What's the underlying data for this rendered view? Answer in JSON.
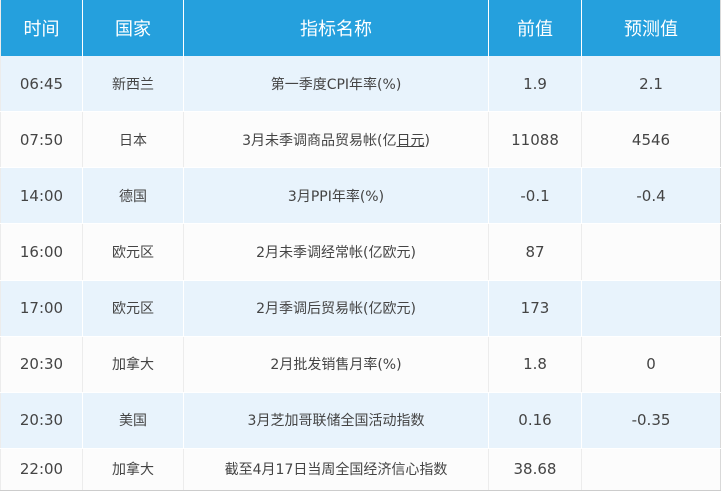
{
  "headers": {
    "time": "时间",
    "country": "国家",
    "indicator": "指标名称",
    "previous": "前值",
    "forecast": "预测值"
  },
  "rows": [
    {
      "time": "06:45",
      "country": "新西兰",
      "indicator": "第一季度CPI年率(%)",
      "previous": "1.9",
      "forecast": "2.1"
    },
    {
      "time": "07:50",
      "country": "日本",
      "indicator_prefix": "3月未季调商品贸易帐(亿",
      "indicator_link": "日元",
      "indicator_suffix": ")",
      "previous": "11088",
      "forecast": "4546"
    },
    {
      "time": "14:00",
      "country": "德国",
      "indicator": "3月PPI年率(%)",
      "previous": "-0.1",
      "forecast": "-0.4"
    },
    {
      "time": "16:00",
      "country": "欧元区",
      "indicator": "2月未季调经常帐(亿欧元)",
      "previous": "87",
      "forecast": ""
    },
    {
      "time": "17:00",
      "country": "欧元区",
      "indicator": "2月季调后贸易帐(亿欧元)",
      "previous": "173",
      "forecast": ""
    },
    {
      "time": "20:30",
      "country": "加拿大",
      "indicator": "2月批发销售月率(%)",
      "previous": "1.8",
      "forecast": "0"
    },
    {
      "time": "20:30",
      "country": "美国",
      "indicator": "3月芝加哥联储全国活动指数",
      "previous": "0.16",
      "forecast": "-0.35"
    },
    {
      "time": "22:00",
      "country": "加拿大",
      "indicator": "截至4月17日当周全国经济信心指数",
      "previous": "38.68",
      "forecast": ""
    }
  ],
  "colors": {
    "header_bg": "#25a0dd",
    "row_alt_bg": "#e8f3fc"
  }
}
